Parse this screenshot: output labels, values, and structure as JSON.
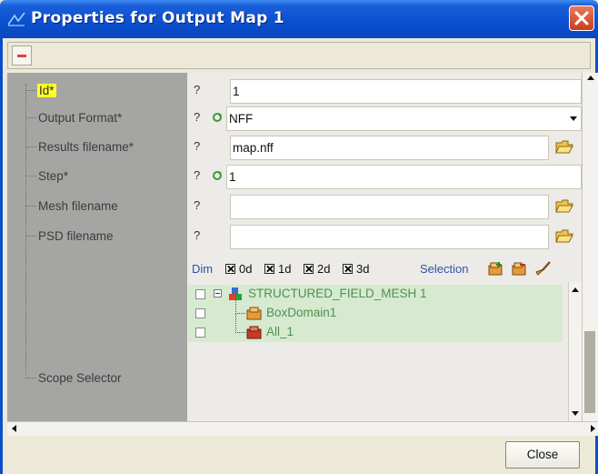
{
  "window": {
    "title": "Properties for Output Map  1"
  },
  "toolbar": {
    "remove_icon": "minus-icon"
  },
  "properties": [
    {
      "label": "Id*",
      "help": "?",
      "value": "1"
    },
    {
      "label": "Output Format*",
      "help": "?",
      "value": "NFF"
    },
    {
      "label": "Results filename*",
      "help": "?",
      "value": "map.nff"
    },
    {
      "label": "Step*",
      "help": "?",
      "value": "1"
    },
    {
      "label": "Mesh filename",
      "help": "?",
      "value": ""
    },
    {
      "label": "PSD filename",
      "help": "?",
      "value": ""
    }
  ],
  "scope": {
    "label": "Scope Selector",
    "dim_label": "Dim",
    "dims": [
      "0d",
      "1d",
      "2d",
      "3d"
    ],
    "selection_label": "Selection",
    "tree": [
      "STRUCTURED_FIELD_MESH 1",
      "BoxDomain1",
      "All_1"
    ]
  },
  "buttons": {
    "close": "Close"
  },
  "colors": {
    "title_bar": "#0a4fd0",
    "highlight": "#ffff2e",
    "tree_row": "#d6ead0",
    "link": "#2c54a8"
  }
}
